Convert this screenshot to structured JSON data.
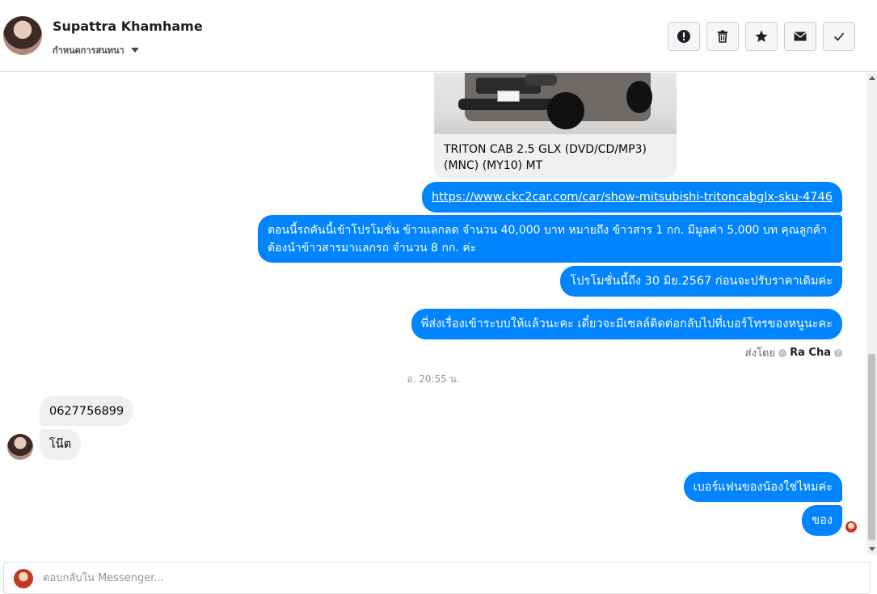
{
  "header": {
    "contact_name": "Supattra Khamhame",
    "conversation_settings": "กำหนดการสนทนา",
    "toolbar": [
      {
        "icon": "alert-icon"
      },
      {
        "icon": "trash-icon"
      },
      {
        "icon": "star-icon"
      },
      {
        "icon": "mail-icon"
      },
      {
        "icon": "check-icon"
      }
    ]
  },
  "conversation": {
    "card_title": "TRITON CAB 2.5 GLX (DVD/CD/MP3) (MNC) (MY10) MT",
    "link_message": "https://www.ckc2car.com/car/show-mitsubishi-tritoncabglx-sku-4746",
    "promo_message": "ตอนนี้รถคันนี้เข้าโปรโมชั่น  ข้าวแลกลด จำนวน 40,000 บาท หมายถึง ข้าวสาร 1 กก. มีมูลค่า 5,000 บท คุณลูกค้าต้องนำข้าวสารมาแลกรถ จำนวน 8  กก. ค่ะ",
    "promo_end_message": "โปรโมชั่นนี้ถึง 30 มิย.2567 ก่อนจะปรับราคาเดิมค่ะ",
    "followup_message": "พี่ส่งเรื่องเข้าระบบให้แล้วนะคะ เดี๋ยวจะมีเซลล์ติดต่อกลับไปที่เบอร์โทรของหนูนะคะ",
    "sent_by_label": "ส่งโดย",
    "sent_by_name": "Ra Cha",
    "timestamp": "อ. 20:55 น.",
    "incoming_phone": "0627756899",
    "incoming_name": "โน๊ต",
    "outgoing_question": "เบอร์แฟนของน้องใช่ไหมค่ะ",
    "outgoing_reply": "ของ"
  },
  "composer": {
    "placeholder": "ตอบกลับใน Messenger..."
  },
  "colors": {
    "outgoing_bubble": "#0084ff",
    "incoming_bubble": "#f1f0f0"
  }
}
